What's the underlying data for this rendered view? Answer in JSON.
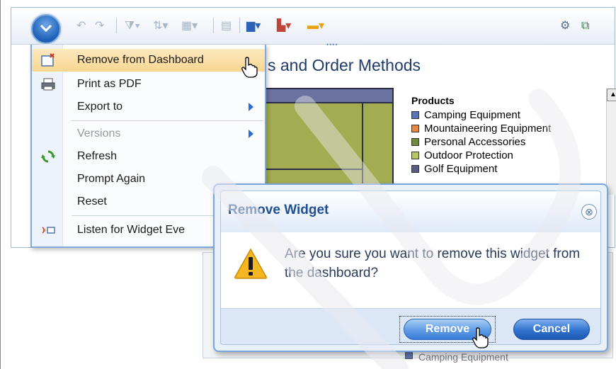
{
  "menu": {
    "items": [
      {
        "label": "Remove from Dashboard",
        "icon": "remove-widget-icon"
      },
      {
        "label": "Print as PDF",
        "icon": "printer-icon"
      },
      {
        "label": "Export to",
        "icon": "",
        "submenu": true
      },
      {
        "label": "Versions",
        "icon": "",
        "submenu": true,
        "disabled": true
      },
      {
        "label": "Refresh",
        "icon": "refresh-icon"
      },
      {
        "label": "Prompt Again",
        "icon": ""
      },
      {
        "label": "Reset",
        "icon": ""
      },
      {
        "label": "Listen for Widget Eve",
        "icon": "widget-events-icon"
      }
    ]
  },
  "widget": {
    "title_fragment": "s and Order Methods"
  },
  "legend": {
    "title": "Products",
    "items": [
      {
        "label": "Camping Equipment",
        "color": "#5b73b5"
      },
      {
        "label": "Mountaineering Equipment",
        "color": "#e28a4a"
      },
      {
        "label": "Personal Accessories",
        "color": "#6f8a3a"
      },
      {
        "label": "Outdoor Protection",
        "color": "#b8c46a"
      },
      {
        "label": "Golf Equipment",
        "color": "#5a5a82"
      }
    ],
    "partial_label": "Camping Equipment"
  },
  "dialog": {
    "title": "Remove Widget",
    "message": "Are you sure you want to remove this widget from the dashboard?",
    "remove_label": "Remove",
    "cancel_label": "Cancel",
    "close_glyph": "⊗"
  },
  "colors": {
    "accent": "#1f4f96",
    "menu_highlight": "#f8d690"
  }
}
